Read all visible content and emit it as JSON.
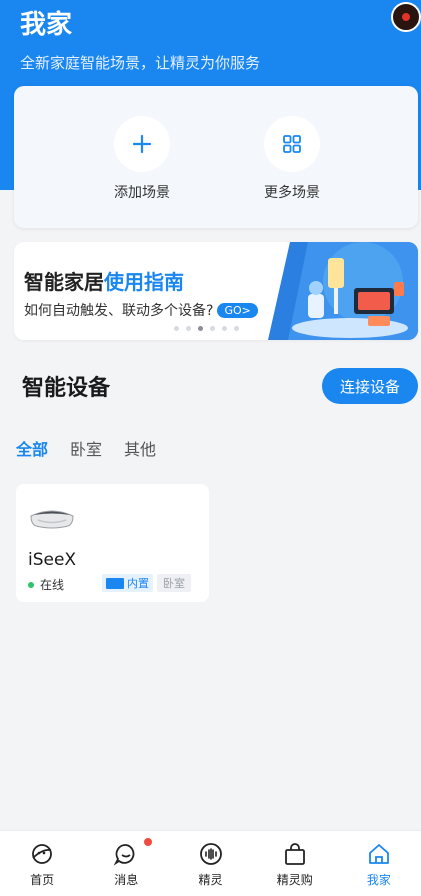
{
  "header": {
    "title": "我家",
    "subtitle": "全新家庭智能场景，让精灵为你服务"
  },
  "scenes": [
    {
      "label": "添加场景",
      "icon": "plus-icon"
    },
    {
      "label": "更多场景",
      "icon": "grid-icon"
    }
  ],
  "banner": {
    "title_main": "智能家居",
    "title_accent": "使用指南",
    "subtitle": "如何自动触发、联动多个设备?",
    "go_label": "GO>",
    "dots_total": 6,
    "dots_active_index": 2
  },
  "devices_section": {
    "title": "智能设备",
    "connect_label": "连接设备",
    "filters": [
      "全部",
      "卧室",
      "其他"
    ],
    "active_filter": 0
  },
  "device": {
    "name": "iSeeX",
    "status": "在线",
    "tag_builtin": "内置",
    "tag_room": "卧室"
  },
  "tabbar": {
    "items": [
      {
        "label": "首页",
        "icon": "planet-icon"
      },
      {
        "label": "消息",
        "icon": "message-icon"
      },
      {
        "label": "精灵",
        "icon": "voice-icon"
      },
      {
        "label": "精灵购",
        "icon": "shopping-bag-icon"
      },
      {
        "label": "我家",
        "icon": "home-icon"
      }
    ],
    "active_index": 4
  },
  "colors": {
    "accent": "#1a86f0",
    "online": "#2bc469",
    "badge": "#f04b3f"
  }
}
